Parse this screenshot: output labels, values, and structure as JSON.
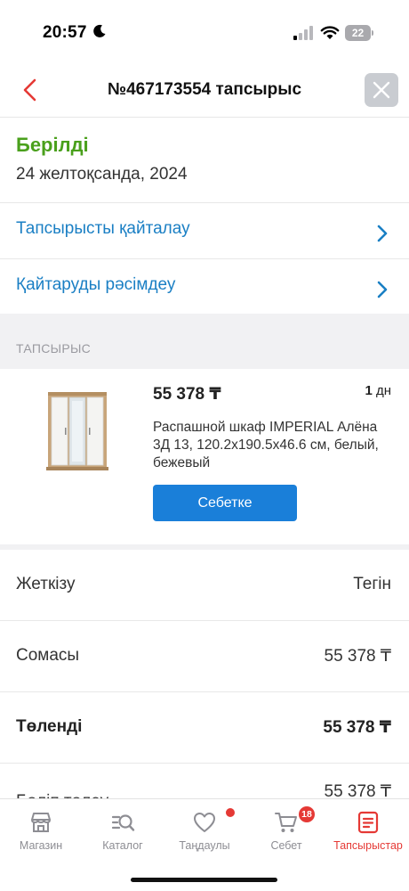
{
  "status_bar": {
    "time": "20:57",
    "battery": "22"
  },
  "header": {
    "title": "№467173554 тапсырыс"
  },
  "order": {
    "status": "Берілді",
    "date": "24 желтоқсанда, 2024"
  },
  "actions": [
    {
      "label": "Тапсырысты қайталау"
    },
    {
      "label": "Қайтаруды рәсімдеу"
    }
  ],
  "section": {
    "label": "ТАПСЫРЫС"
  },
  "product": {
    "price": "55 378 ₸",
    "qty_number": "1",
    "qty_unit": "дн",
    "name": "Распашной шкаф IMPERIAL Алёна 3Д 13, 120.2x190.5x46.6 см, белый, бежевый",
    "cart_button": "Себетке"
  },
  "summary": [
    {
      "label": "Жеткізу",
      "value": "Тегін"
    },
    {
      "label": "Сомасы",
      "value": "55 378 ₸"
    },
    {
      "label": "Төленді",
      "value": "55 378 ₸"
    },
    {
      "label": "Бөліп төлеу",
      "value": "55 378 ₸"
    }
  ],
  "nav": [
    {
      "label": "Магазин"
    },
    {
      "label": "Каталог"
    },
    {
      "label": "Таңдаулы"
    },
    {
      "label": "Себет"
    },
    {
      "label": "Тапсырыстар"
    }
  ],
  "cart_badge": "18",
  "colors": {
    "accent_blue": "#1a7fc4",
    "status_green": "#4aa01c",
    "active_red": "#e53935"
  }
}
